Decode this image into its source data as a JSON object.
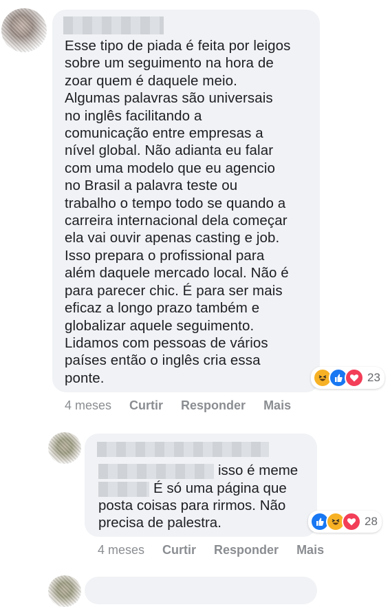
{
  "comment1": {
    "text": "Esse tipo de piada é feita por leigos\nsobre um seguimento na hora de\nzoar quem é daquele meio.\nAlgumas palavras são universais\nno inglês facilitando a\ncomunicação entre empresas a\nnível global. Não adianta eu falar\ncom uma modelo que eu agencio\nno Brasil a palavra teste ou\ntrabalho o tempo todo se quando a\ncarreira internacional dela começar\nela vai ouvir apenas casting e job.\nIsso prepara o profissional para\nalém daquele mercado local. Não é\npara parecer chic. É para ser mais\neficaz a longo prazo também e\nglobalizar aquele seguimento.\nLidamos com pessoas de vários\npaíses então o inglês cria essa\nponte.",
    "reaction_count": "23",
    "reaction_icons": [
      "haha-icon",
      "like-icon",
      "love-icon"
    ],
    "actions": {
      "time": "4 meses",
      "like": "Curtir",
      "reply": "Responder",
      "more": "Mais"
    }
  },
  "comment2": {
    "line1_suffix": "isso é meme",
    "line2_suffix": "É só uma página que",
    "line3": "posta coisas para rirmos. Não",
    "line4": "precisa de palestra.",
    "reaction_count": "28",
    "reaction_icons": [
      "like-icon",
      "haha-icon",
      "love-icon"
    ],
    "actions": {
      "time": "4 meses",
      "like": "Curtir",
      "reply": "Responder",
      "more": "Mais"
    }
  },
  "colors": {
    "bubble": "#f0f2f5",
    "meta": "#8a8d91",
    "like": "#1877f2",
    "love": "#f33e58",
    "haha": "#f7b125"
  }
}
